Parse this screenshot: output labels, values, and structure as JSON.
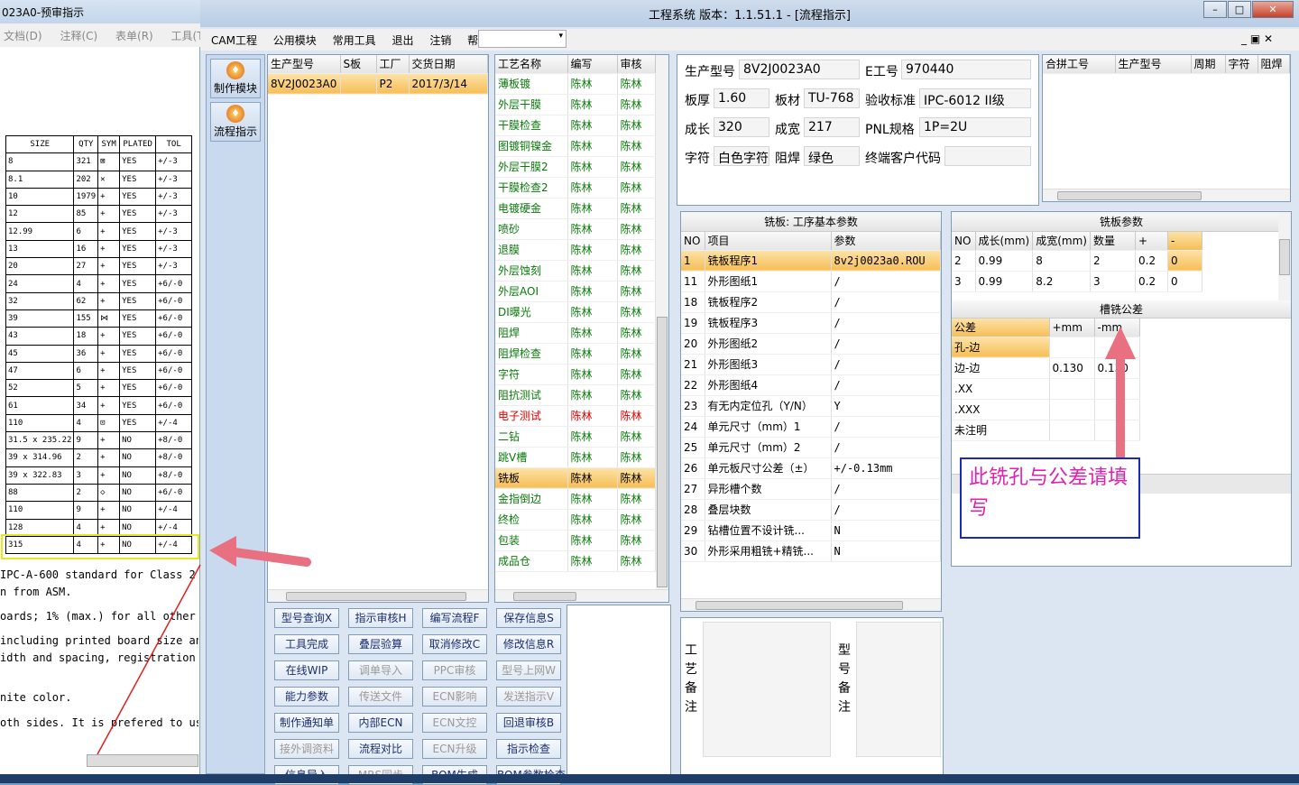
{
  "bg": {
    "title": "023A0-预审指示",
    "menu": [
      "文档(D)",
      "注释(C)",
      "表单(R)",
      "工具(T)"
    ],
    "drill_headers": [
      "SIZE",
      "QTY",
      "SYM",
      "PLATED",
      "TOL"
    ],
    "drill_rows": [
      [
        "8",
        "321",
        "⊠",
        "YES",
        "+/-3"
      ],
      [
        "8.1",
        "202",
        "✕",
        "YES",
        "+/-3"
      ],
      [
        "10",
        "1979",
        "+",
        "YES",
        "+/-3"
      ],
      [
        "12",
        "85",
        "+",
        "YES",
        "+/-3"
      ],
      [
        "12.99",
        "6",
        "+",
        "YES",
        "+/-3"
      ],
      [
        "13",
        "16",
        "+",
        "YES",
        "+/-3"
      ],
      [
        "20",
        "27",
        "+",
        "YES",
        "+/-3"
      ],
      [
        "24",
        "4",
        "+",
        "YES",
        "+6/-0"
      ],
      [
        "32",
        "62",
        "+",
        "YES",
        "+6/-0"
      ],
      [
        "39",
        "155",
        "⋈",
        "YES",
        "+6/-0"
      ],
      [
        "43",
        "18",
        "+",
        "YES",
        "+6/-0"
      ],
      [
        "45",
        "36",
        "+",
        "YES",
        "+6/-0"
      ],
      [
        "47",
        "6",
        "+",
        "YES",
        "+6/-0"
      ],
      [
        "52",
        "5",
        "+",
        "YES",
        "+6/-0"
      ],
      [
        "61",
        "34",
        "+",
        "YES",
        "+6/-0"
      ],
      [
        "110",
        "4",
        "⊡",
        "YES",
        "+/-4"
      ],
      [
        "31.5 x 235.22",
        "9",
        "+",
        "NO",
        "+8/-0"
      ],
      [
        "39 x 314.96",
        "2",
        "+",
        "NO",
        "+8/-0"
      ],
      [
        "39 x 322.83",
        "3",
        "+",
        "NO",
        "+8/-0"
      ],
      [
        "88",
        "2",
        "◇",
        "NO",
        "+6/-0"
      ],
      [
        "110",
        "9",
        "+",
        "NO",
        "+/-4"
      ],
      [
        "128",
        "4",
        "+",
        "NO",
        "+/-4"
      ],
      [
        "315",
        "4",
        "+",
        "NO",
        "+/-4"
      ]
    ],
    "notes": [
      "IPC-A-600 standard for Class 2 p",
      "n from ASM.",
      "oards; 1% (max.) for all other boa",
      "including printed board size and t",
      "idth and spacing, registration and",
      "nite color.",
      "oth sides. It is prefered to use"
    ]
  },
  "app": {
    "title": "工程系统   版本：1.1.51.1 - [流程指示]",
    "menu": [
      "CAM工程",
      "公用模块",
      "常用工具",
      "退出",
      "注销",
      "帮助 ▾"
    ],
    "side": [
      "制作模块",
      "流程指示"
    ]
  },
  "orders": {
    "headers": [
      "生产型号",
      "S板",
      "工厂",
      "交货日期"
    ],
    "rows": [
      [
        "8V2J0023A0",
        "",
        "P2",
        "2017/3/14"
      ]
    ]
  },
  "process": {
    "headers": [
      "工艺名称",
      "编写",
      "审核"
    ],
    "rows": [
      [
        "薄板镀",
        "陈林",
        "陈林"
      ],
      [
        "外层干膜",
        "陈林",
        "陈林"
      ],
      [
        "干膜检查",
        "陈林",
        "陈林"
      ],
      [
        "图镀铜镍金",
        "陈林",
        "陈林"
      ],
      [
        "外层干膜2",
        "陈林",
        "陈林"
      ],
      [
        "干膜检查2",
        "陈林",
        "陈林"
      ],
      [
        "电镀硬金",
        "陈林",
        "陈林"
      ],
      [
        "喷砂",
        "陈林",
        "陈林"
      ],
      [
        "退膜",
        "陈林",
        "陈林"
      ],
      [
        "外层蚀刻",
        "陈林",
        "陈林"
      ],
      [
        "外层AOI",
        "陈林",
        "陈林"
      ],
      [
        "DI曝光",
        "陈林",
        "陈林"
      ],
      [
        "阻焊",
        "陈林",
        "陈林"
      ],
      [
        "阻焊检查",
        "陈林",
        "陈林"
      ],
      [
        "字符",
        "陈林",
        "陈林"
      ],
      [
        "阻抗测试",
        "陈林",
        "陈林"
      ],
      [
        "电子测试",
        "陈林",
        "陈林"
      ],
      [
        "二钻",
        "陈林",
        "陈林"
      ],
      [
        "跳V槽",
        "陈林",
        "陈林"
      ],
      [
        "铣板",
        "陈林",
        "陈林"
      ],
      [
        "金指倒边",
        "陈林",
        "陈林"
      ],
      [
        "终检",
        "陈林",
        "陈林"
      ],
      [
        "包装",
        "陈林",
        "陈林"
      ],
      [
        "成品仓",
        "陈林",
        "陈林"
      ]
    ]
  },
  "buttons": [
    [
      "型号查询X",
      "指示审核H",
      "编写流程F",
      "保存信息S"
    ],
    [
      "工具完成",
      "叠层验算",
      "取消修改C",
      "修改信息R"
    ],
    [
      "在线WIP",
      "调单导入",
      "PPC审核",
      "型号上网W"
    ],
    [
      "能力参数",
      "传送文件",
      "ECN影响",
      "发送指示V"
    ],
    [
      "制作通知单",
      "内部ECN",
      "ECN文控",
      "回退审核B"
    ],
    [
      "接外调资料",
      "流程对比",
      "ECN升级",
      "指示检查"
    ],
    [
      "信息导入",
      "MRS同步",
      "BOM生成",
      "BOM参数检查"
    ]
  ],
  "info": {
    "l_model": "生产型号",
    "model": "8V2J0023A0",
    "l_e": "E工号",
    "e": "970440",
    "l_thick": "板厚",
    "thick": "1.60",
    "l_mat": "板材",
    "mat": "TU-768",
    "l_std": "验收标准",
    "std": "IPC-6012 II级",
    "l_len": "成长",
    "len": "320",
    "l_wid": "成宽",
    "wid": "217",
    "l_pnl": "PNL规格",
    "pnl": "1P=2U",
    "l_char": "字符",
    "char": "白色字符",
    "l_mask": "阻焊",
    "mask": "绿色",
    "l_cust": "终端客户代码",
    "cust": ""
  },
  "merge": {
    "headers": [
      "合拼工号",
      "生产型号",
      "周期",
      "字符",
      "阻焊"
    ]
  },
  "basic": {
    "title": "铣板: 工序基本参数",
    "headers": [
      "NO",
      "项目",
      "参数"
    ],
    "rows": [
      [
        "1",
        "铣板程序1",
        "8v2j0023a0.ROU"
      ],
      [
        "11",
        "外形图纸1",
        "/"
      ],
      [
        "18",
        "铣板程序2",
        "/"
      ],
      [
        "19",
        "铣板程序3",
        "/"
      ],
      [
        "20",
        "外形图纸2",
        "/"
      ],
      [
        "21",
        "外形图纸3",
        "/"
      ],
      [
        "22",
        "外形图纸4",
        "/"
      ],
      [
        "23",
        "有无内定位孔（Y/N）",
        "Y"
      ],
      [
        "24",
        "单元尺寸（mm）1",
        "/"
      ],
      [
        "25",
        "单元尺寸（mm）2",
        "/"
      ],
      [
        "26",
        "单元板尺寸公差（±）",
        "+/-0.13mm"
      ],
      [
        "27",
        "异形槽个数",
        "/"
      ],
      [
        "28",
        "叠层块数",
        "/"
      ],
      [
        "29",
        "钻槽位置不设计铣...",
        "N"
      ],
      [
        "30",
        "外形采用粗铣+精铣...",
        "N"
      ]
    ]
  },
  "mill": {
    "title": "铣板参数",
    "headers": [
      "NO",
      "成长(mm)",
      "成宽(mm)",
      "数量",
      "+",
      "-"
    ],
    "rows": [
      [
        "2",
        "0.99",
        "8",
        "2",
        "0.2",
        "0"
      ],
      [
        "3",
        "0.99",
        "8.2",
        "3",
        "0.2",
        "0"
      ]
    ]
  },
  "slot": {
    "title": "槽铣公差",
    "headers": [
      "公差",
      "+mm",
      "-mm"
    ],
    "rows": [
      [
        "孔-边",
        "",
        ""
      ],
      [
        "边-边",
        "0.130",
        "0.130"
      ],
      [
        ".XX",
        "",
        ""
      ],
      [
        ".XXX",
        "",
        ""
      ],
      [
        "未注明",
        "",
        ""
      ]
    ]
  },
  "remarks": {
    "process": "工艺备注",
    "model": "型号备注"
  },
  "annotation": "此铣孔与公差请填写"
}
